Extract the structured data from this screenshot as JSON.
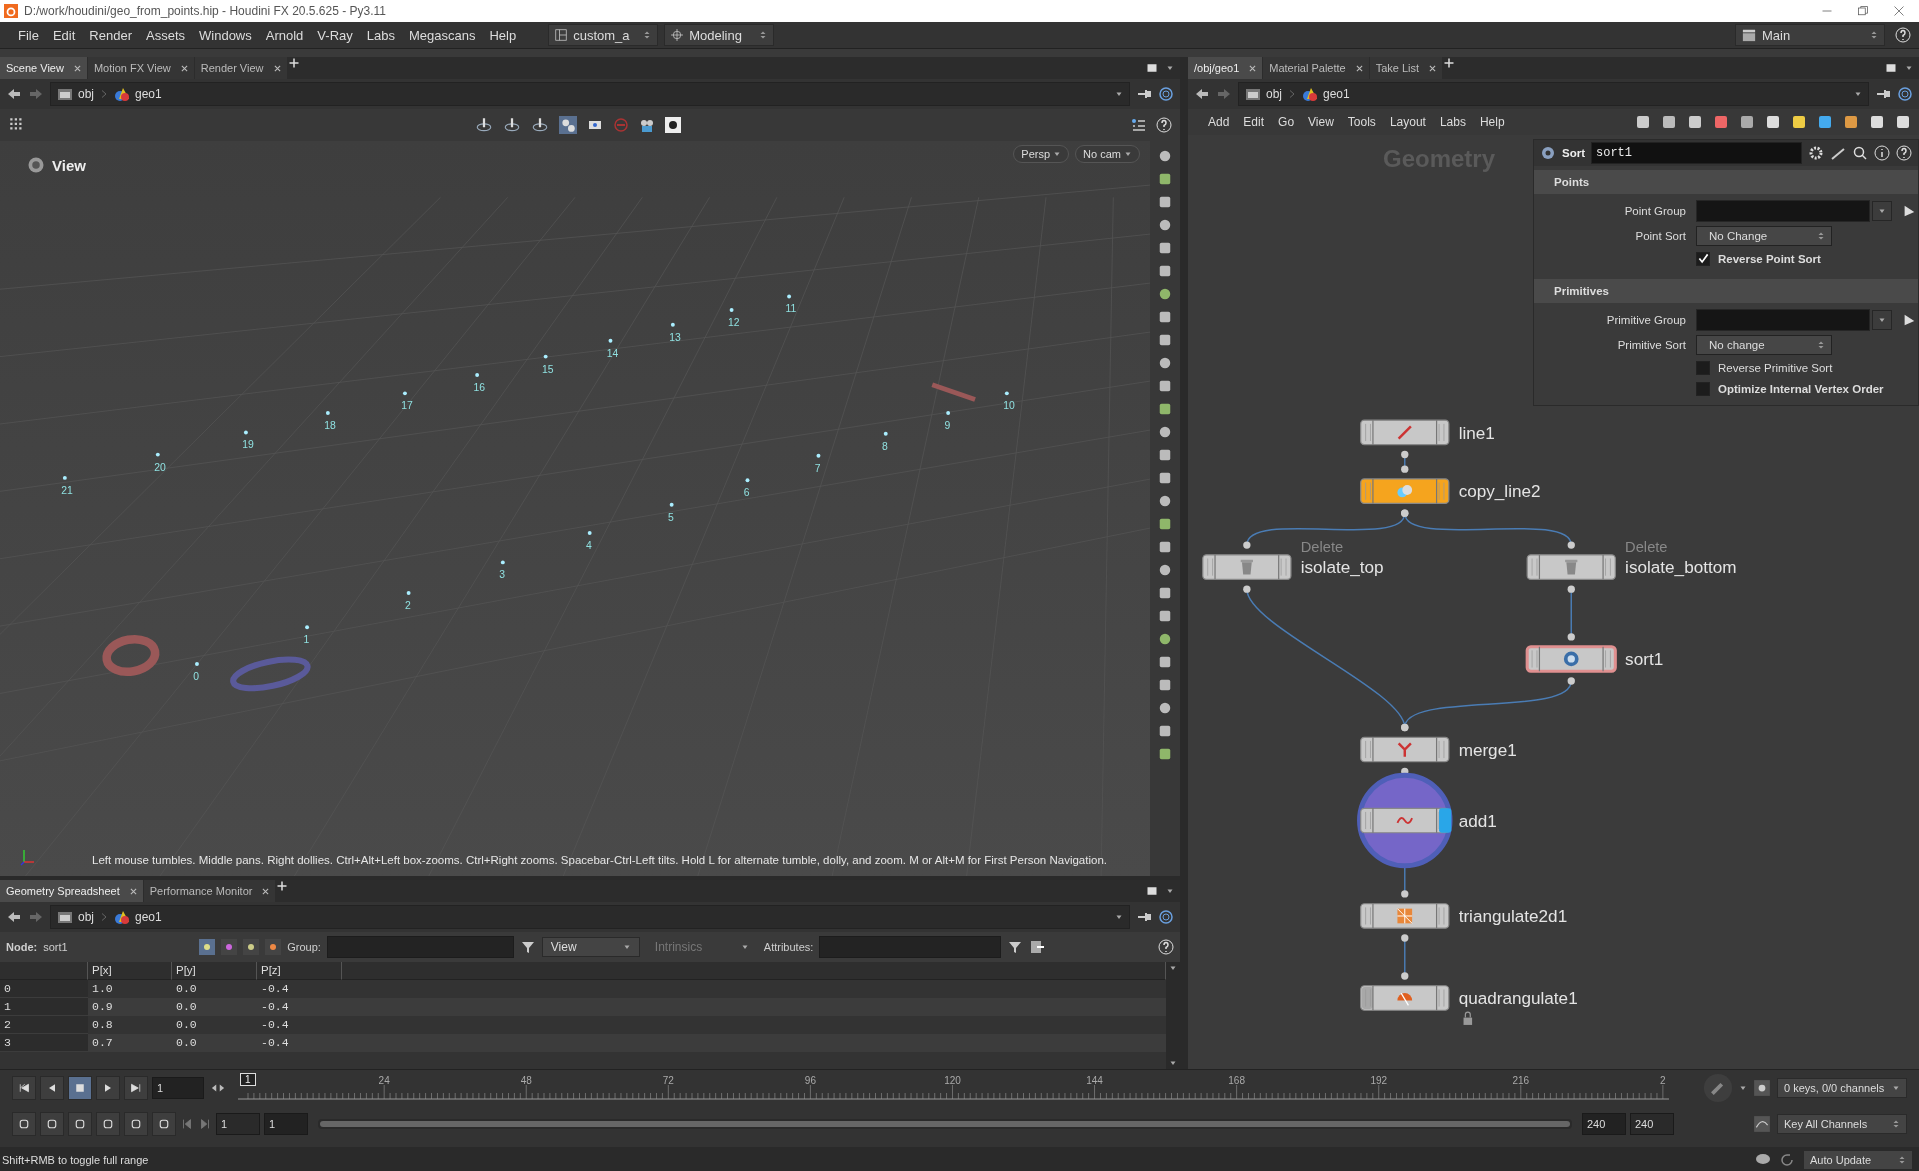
{
  "window": {
    "title": "D:/work/houdini/geo_from_points.hip - Houdini FX 20.5.625 - Py3.11"
  },
  "menu_bar": [
    "File",
    "Edit",
    "Render",
    "Assets",
    "Windows",
    "Arnold",
    "V-Ray",
    "Labs",
    "Megascans",
    "Help"
  ],
  "desktop_selectors": [
    "custom_a",
    "Modeling"
  ],
  "run_menu": "Main",
  "scene_pane": {
    "tabs": [
      {
        "label": "Scene View",
        "selected": true
      },
      {
        "label": "Motion FX View",
        "selected": false
      },
      {
        "label": "Render View",
        "selected": false
      }
    ],
    "path": [
      "obj",
      "geo1"
    ]
  },
  "viewport": {
    "title": "View",
    "camera_menus": [
      "Persp",
      "No cam"
    ],
    "point_numbers": [
      "0",
      "1",
      "2",
      "3",
      "4",
      "5",
      "6",
      "7",
      "8",
      "9",
      "10",
      "11",
      "12",
      "13",
      "14",
      "15",
      "16",
      "17",
      "18",
      "19",
      "20",
      "21"
    ],
    "hint": "Left mouse tumbles. Middle pans. Right dollies. Ctrl+Alt+Left box-zooms. Ctrl+Right zooms. Spacebar-Ctrl-Left tilts. Hold L for alternate tumble, dolly, and zoom. M or Alt+M for First Person Navigation."
  },
  "spreadsheet_pane": {
    "tabs": [
      {
        "label": "Geometry Spreadsheet",
        "selected": true
      },
      {
        "label": "Performance Monitor",
        "selected": false
      }
    ],
    "path": [
      "obj",
      "geo1"
    ],
    "node_label": "Node:",
    "node_name": "sort1",
    "group_label": "Group:",
    "view_menu": "View",
    "intrinsics_menu": {
      "label": "Intrinsics",
      "disabled": true
    },
    "attributes_label": "Attributes:",
    "columns": [
      "P[x]",
      "P[y]",
      "P[z]"
    ],
    "rows": [
      {
        "index": "0",
        "values": [
          "1.0",
          "0.0",
          "-0.4"
        ]
      },
      {
        "index": "1",
        "values": [
          "0.9",
          "0.0",
          "-0.4"
        ]
      },
      {
        "index": "2",
        "values": [
          "0.8",
          "0.0",
          "-0.4"
        ]
      },
      {
        "index": "3",
        "values": [
          "0.7",
          "0.0",
          "-0.4"
        ]
      }
    ]
  },
  "network_pane": {
    "tabs": [
      {
        "label": "/obj/geo1",
        "selected": true
      },
      {
        "label": "Material Palette",
        "selected": false
      },
      {
        "label": "Take List",
        "selected": false
      }
    ],
    "path": [
      "obj",
      "geo1"
    ],
    "menu": [
      "Add",
      "Edit",
      "Go",
      "View",
      "Tools",
      "Layout",
      "Labs",
      "Help"
    ],
    "context": "Geometry",
    "nodes": [
      {
        "name": "line1",
        "kind": "line",
        "color": "#c8c8c8",
        "selected": false,
        "display": false,
        "locked": false
      },
      {
        "name": "copy_line2",
        "kind": "copy",
        "color": "#f5a41e",
        "selected": false,
        "display": false,
        "locked": false
      },
      {
        "name": "isolate_top",
        "type_label": "Delete",
        "kind": "delete",
        "color": "#c8c8c8",
        "selected": false,
        "display": false,
        "locked": false
      },
      {
        "name": "isolate_bottom",
        "type_label": "Delete",
        "kind": "delete",
        "color": "#c8c8c8",
        "selected": false,
        "display": false,
        "locked": false
      },
      {
        "name": "sort1",
        "kind": "sort",
        "color": "#c8c8c8",
        "selected": true,
        "display": false,
        "locked": false
      },
      {
        "name": "merge1",
        "kind": "merge",
        "color": "#c8c8c8",
        "selected": false,
        "display": false,
        "locked": false
      },
      {
        "name": "add1",
        "kind": "add",
        "color": "#c8c8c8",
        "selected": false,
        "display": true,
        "locked": false
      },
      {
        "name": "triangulate2d1",
        "kind": "triangulate",
        "color": "#c8c8c8",
        "selected": false,
        "display": false,
        "locked": false
      },
      {
        "name": "quadrangulate1",
        "kind": "quadrangulate",
        "color": "#c8c8c8",
        "selected": false,
        "display": false,
        "locked": true
      }
    ]
  },
  "parameters": {
    "node_type": "Sort",
    "node_name": "sort1",
    "sections": [
      {
        "title": "Points",
        "params": [
          {
            "kind": "group",
            "label": "Point Group"
          },
          {
            "kind": "menu",
            "label": "Point Sort",
            "value": "No Change"
          },
          {
            "kind": "toggle",
            "label": "Reverse Point Sort",
            "checked": true,
            "emphasized": true
          }
        ]
      },
      {
        "title": "Primitives",
        "params": [
          {
            "kind": "group",
            "label": "Primitive Group"
          },
          {
            "kind": "menu",
            "label": "Primitive Sort",
            "value": "No change"
          },
          {
            "kind": "toggle",
            "label": "Reverse Primitive Sort",
            "checked": false,
            "emphasized": false
          },
          {
            "kind": "toggle",
            "label": "Optimize Internal Vertex Order",
            "checked": false,
            "emphasized": true
          }
        ]
      }
    ]
  },
  "timeline": {
    "current_frame": "1",
    "marker": "1",
    "ticks": [
      "24",
      "48",
      "72",
      "96",
      "120",
      "144",
      "168",
      "192",
      "216",
      "2"
    ],
    "range_slider": {
      "level": 1
    },
    "range_start": "1",
    "range_start_2": "1",
    "range_end": "240",
    "range_end_2": "240",
    "keys_info": "0 keys, 0/0 channels",
    "key_menu": "Key All Channels"
  },
  "status_bar": {
    "message": "Shift+RMB to toggle full range",
    "update_mode": "Auto Update"
  }
}
